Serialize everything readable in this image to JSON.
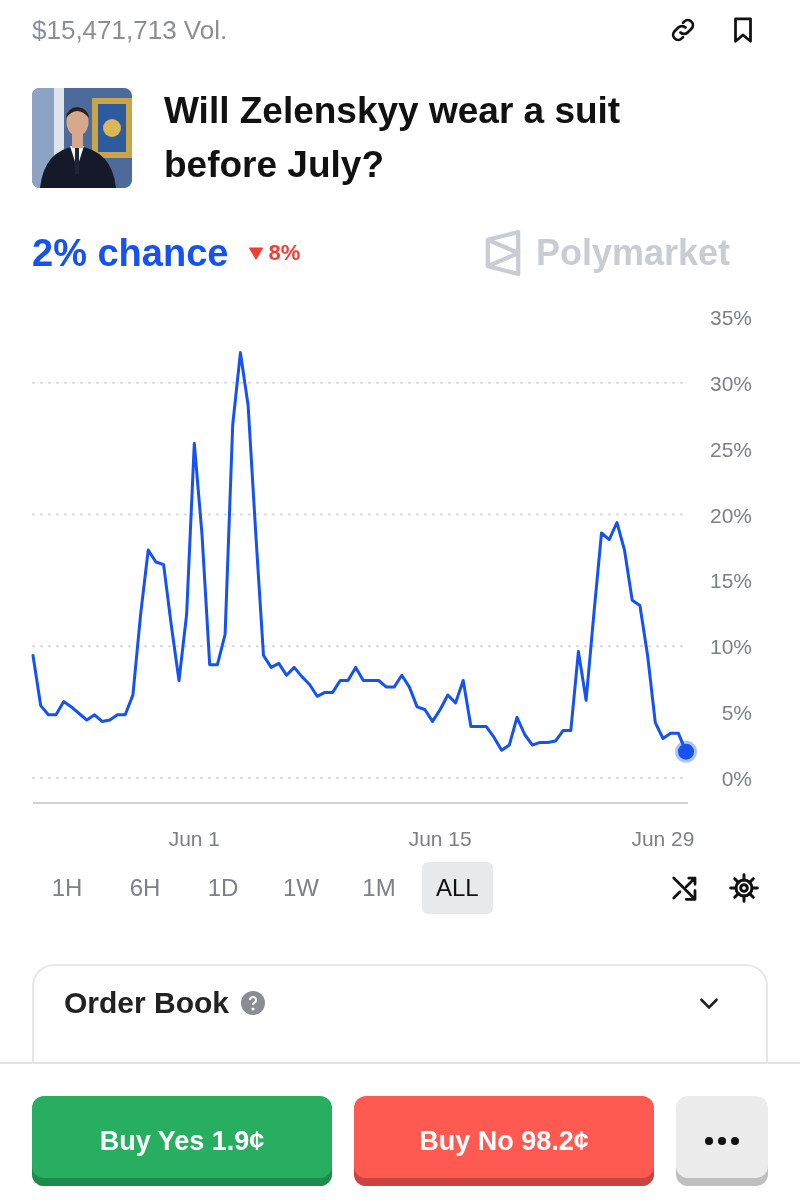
{
  "header": {
    "volume": "$15,471,713 Vol."
  },
  "market": {
    "title": "Will Zelenskyy wear a suit before July?"
  },
  "probability": {
    "chance": "2% chance",
    "change": {
      "kind": "down",
      "value": "8%"
    }
  },
  "brand": {
    "name": "Polymarket"
  },
  "chart": {
    "chart_data": {
      "type": "line",
      "categories": [
        null,
        null,
        null,
        null,
        null,
        null,
        null,
        null,
        null,
        null,
        null,
        null,
        null,
        null,
        null,
        null,
        null,
        null,
        null,
        null,
        null,
        "Jun 1",
        null,
        null,
        null,
        null,
        null,
        null,
        null,
        null,
        null,
        null,
        null,
        null,
        null,
        null,
        null,
        null,
        null,
        null,
        null,
        null,
        null,
        null,
        null,
        null,
        null,
        null,
        null,
        null,
        null,
        null,
        null,
        "Jun 15",
        null,
        null,
        null,
        null,
        null,
        null,
        null,
        null,
        null,
        null,
        null,
        null,
        null,
        null,
        null,
        null,
        null,
        null,
        null,
        null,
        null,
        null,
        null,
        null,
        null,
        null,
        null,
        null,
        "Jun 29",
        null,
        null,
        null
      ],
      "series": [
        {
          "color": "#1652f0",
          "values": [
            9.3,
            5.5,
            4.8,
            4.8,
            5.8,
            5.4,
            4.9,
            4.4,
            4.8,
            4.3,
            4.4,
            4.8,
            4.8,
            6.3,
            12.4,
            17.3,
            16.4,
            16.2,
            11.6,
            7.4,
            12.4,
            25.4,
            18.5,
            8.6,
            8.6,
            10.9,
            26.8,
            32.3,
            28.3,
            18.5,
            9.3,
            8.4,
            8.7,
            7.8,
            8.4,
            7.7,
            7.1,
            6.2,
            6.5,
            6.5,
            7.4,
            7.4,
            8.4,
            7.4,
            7.4,
            7.4,
            6.9,
            6.9,
            7.8,
            6.9,
            5.4,
            5.2,
            4.3,
            5.2,
            6.3,
            5.7,
            7.4,
            3.9,
            3.9,
            3.9,
            3.1,
            2.1,
            2.5,
            4.6,
            3.3,
            2.5,
            2.7,
            2.7,
            2.8,
            3.6,
            3.6,
            9.6,
            5.9,
            12.4,
            18.6,
            18.1,
            19.4,
            17.3,
            13.5,
            13.1,
            9.3,
            4.2,
            3.0,
            3.4,
            3.4,
            2.0
          ]
        }
      ],
      "ylim": [
        0,
        35
      ],
      "grid": true,
      "yticks": [
        {
          "value": 0,
          "label": "0%"
        },
        {
          "value": 5,
          "label": "5%"
        },
        {
          "value": 10,
          "label": "10%"
        },
        {
          "value": 15,
          "label": "15%"
        },
        {
          "value": 20,
          "label": "20%"
        },
        {
          "value": 25,
          "label": "25%"
        },
        {
          "value": 30,
          "label": "30%"
        },
        {
          "value": 35,
          "label": "35%"
        }
      ]
    }
  },
  "ranges": [
    {
      "label": "1H",
      "selected": false
    },
    {
      "label": "6H",
      "selected": false
    },
    {
      "label": "1D",
      "selected": false
    },
    {
      "label": "1W",
      "selected": false
    },
    {
      "label": "1M",
      "selected": false
    },
    {
      "label": "ALL",
      "selected": true
    }
  ],
  "order_book": {
    "title": "Order Book"
  },
  "actions": [
    {
      "kind": "yes",
      "label": "Buy Yes 1.9¢"
    },
    {
      "kind": "no",
      "label": "Buy No 98.2¢"
    }
  ]
}
